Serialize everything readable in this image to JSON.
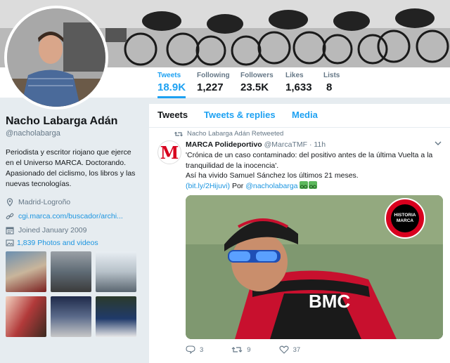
{
  "stats": [
    {
      "label": "Tweets",
      "value": "18.9K",
      "active": true
    },
    {
      "label": "Following",
      "value": "1,227"
    },
    {
      "label": "Followers",
      "value": "23.5K"
    },
    {
      "label": "Likes",
      "value": "1,633"
    },
    {
      "label": "Lists",
      "value": "8"
    }
  ],
  "profile": {
    "name": "Nacho Labarga Adán",
    "handle": "@nacholabarga",
    "bio": "Periodista y escritor riojano que ejerce en el Universo MARCA. Doctorando. Apasionado del ciclismo, los libros y las nuevas tecnologías.",
    "location": "Madrid-Logroño",
    "website": "cgi.marca.com/buscador/archi...",
    "joined": "Joined January 2009",
    "photos_label": "1,839 Photos and videos"
  },
  "tabs": [
    "Tweets",
    "Tweets & replies",
    "Media"
  ],
  "tweet": {
    "retweeted_by": "Nacho Labarga Adán Retweeted",
    "avatar_letter": "M",
    "author": "MARCA Polideportivo",
    "handle": "@MarcaTMF",
    "time": "· 11h",
    "text_line1": "'Crónica de un caso contaminado: del positivo antes de la última Vuelta a la tranquilidad de la inocencia'.",
    "text_line2": "Así ha vivido Samuel Sánchez los últimos 21 meses.",
    "link": "(bit.ly/2Hijuvi)",
    "por": "Por",
    "mention": "@nacholabarga",
    "badge_text": "HISTORIA MARCA",
    "replies": "3",
    "retweets": "9",
    "likes": "37"
  },
  "colors": {
    "accent": "#1da1f2",
    "marca_red": "#d8001e"
  }
}
